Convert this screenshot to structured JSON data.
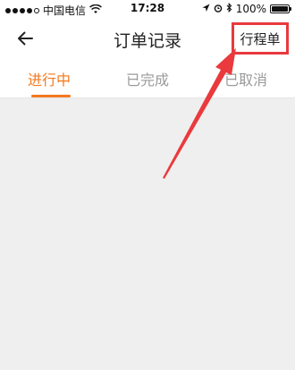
{
  "status_bar": {
    "carrier": "中国电信",
    "time": "17:28",
    "battery_text": "100%",
    "battery_level": 1.0,
    "icons": [
      "signal-dots-icon",
      "wifi-icon",
      "location-arrow-icon",
      "alarm-icon",
      "bluetooth-icon",
      "battery-icon"
    ]
  },
  "navbar": {
    "title": "订单记录",
    "right_button": "行程单",
    "back_icon": "back-arrow-icon"
  },
  "tabs": [
    {
      "label": "进行中",
      "active": true
    },
    {
      "label": "已完成",
      "active": false
    },
    {
      "label": "已取消",
      "active": false
    }
  ],
  "annotation": {
    "color": "#e8393e",
    "icon": "red-arrow-annotation"
  },
  "colors": {
    "accent": "#f5781e",
    "highlight": "#e8393e",
    "background": "#efefef"
  }
}
